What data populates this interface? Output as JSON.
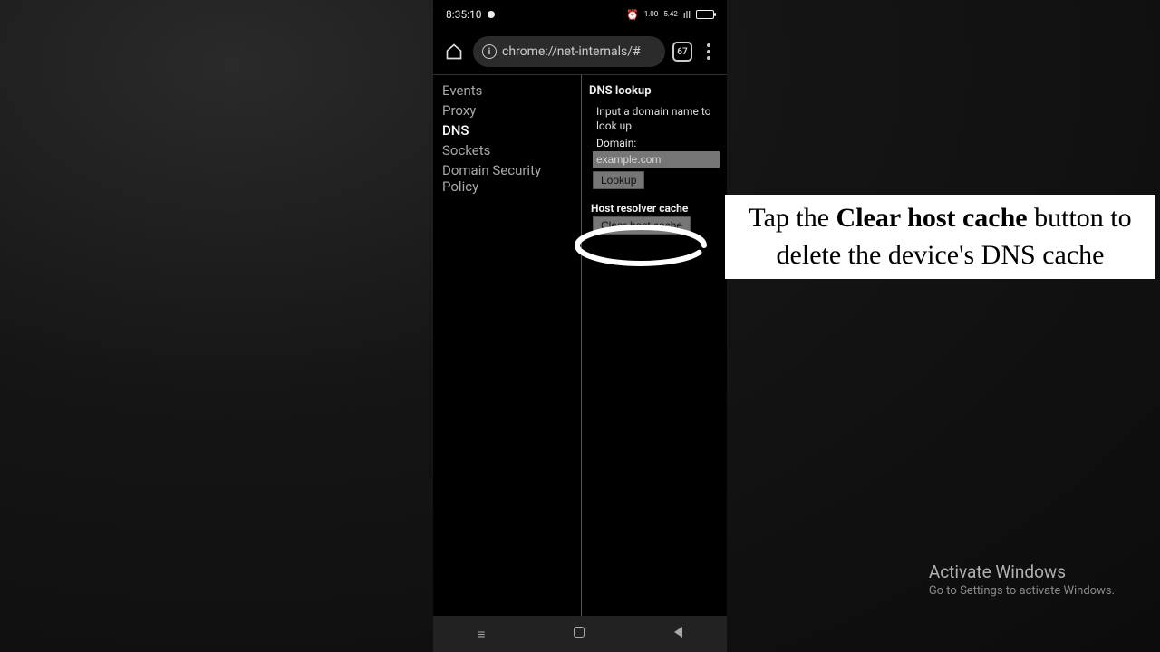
{
  "status": {
    "time": "8:35:10",
    "icons": {
      "alarm": "⏰",
      "net1": "1.00",
      "net2": "5.42",
      "signal": "ıll"
    }
  },
  "chrome": {
    "url": "chrome://net-internals/#",
    "tab_count": "67"
  },
  "nav": {
    "items": [
      "Events",
      "Proxy",
      "DNS",
      "Sockets",
      "Domain Security Policy"
    ],
    "active_index": 2
  },
  "dns": {
    "lookup_title": "DNS lookup",
    "instruction": "Input a domain name to look up:",
    "domain_label": "Domain:",
    "placeholder": "example.com",
    "lookup_btn": "Lookup",
    "resolver_title": "Host resolver cache",
    "clear_btn": "Clear host cache"
  },
  "callout": {
    "pre": "Tap the ",
    "bold": "Clear host cache",
    "post1": " button to delete the device's DNS cache"
  },
  "watermark": {
    "line1": "Activate Windows",
    "line2": "Go to Settings to activate Windows."
  }
}
